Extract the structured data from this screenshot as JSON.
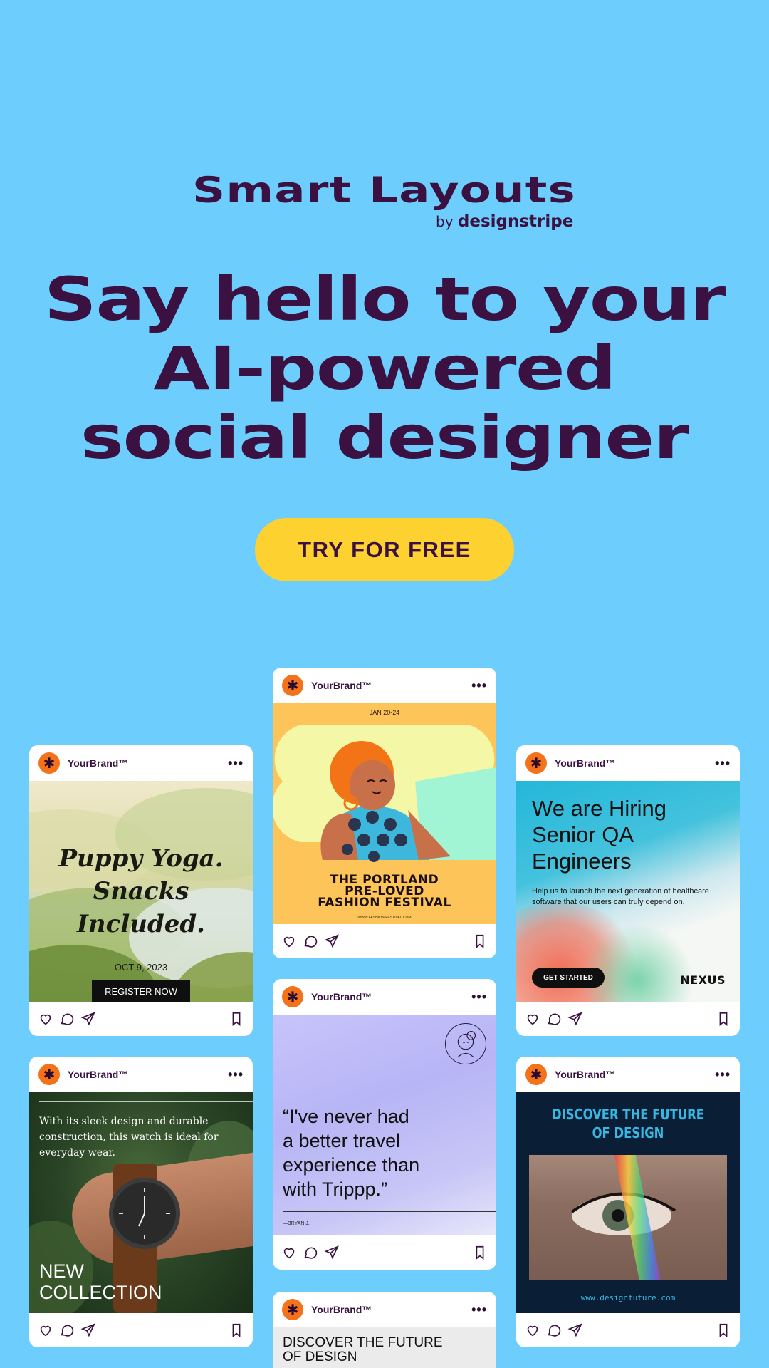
{
  "logo": {
    "title": "Smart Layouts",
    "by": "by",
    "company": "designstripe"
  },
  "headline": {
    "line1": "Say hello to your",
    "line2": "AI-powered",
    "line3": "social designer"
  },
  "cta": {
    "label": "TRY FOR FREE"
  },
  "brand": {
    "name": "YourBrand™",
    "menu": "•••",
    "logo_glyph": "✱"
  },
  "colors": {
    "background": "#6dcdfd",
    "primary": "#3a1140",
    "cta": "#fdd12f",
    "brand_dot": "#f4731a"
  },
  "cards": {
    "puppy": {
      "title_line1": "Puppy Yoga.",
      "title_line2": "Snacks Included.",
      "date": "OCT 9, 2023",
      "button": "REGISTER NOW"
    },
    "festival": {
      "date": "JAN 20-24",
      "title_line1": "THE PORTLAND",
      "title_line2": "PRE-LOVED",
      "title_line3": "FASHION FESTIVAL",
      "url": "WWW.FASHION-FESTIVAL.COM"
    },
    "hiring": {
      "title_line1": "We are Hiring",
      "title_line2": "Senior QA",
      "title_line3": "Engineers",
      "body": "Help us to launch the next generation of healthcare software that our users can truly depend on.",
      "button": "GET STARTED",
      "company": "NEXUS"
    },
    "watch": {
      "body": "With its sleek design and durable construction, this watch is ideal for everyday wear.",
      "title_line1": "NEW",
      "title_line2": "COLLECTION"
    },
    "testimonial": {
      "quote_line1": "“I've never had",
      "quote_line2": "a better travel",
      "quote_line3": "experience than",
      "quote_line4": "with Trippp.”",
      "author": "—BRYAN J."
    },
    "eye": {
      "title_line1": "DISCOVER THE FUTURE",
      "title_line2": "OF DESIGN",
      "url": "www.designfuture.com"
    },
    "partial": {
      "title_line1": "DISCOVER THE FUTURE",
      "title_line2": "OF DESIGN"
    }
  }
}
